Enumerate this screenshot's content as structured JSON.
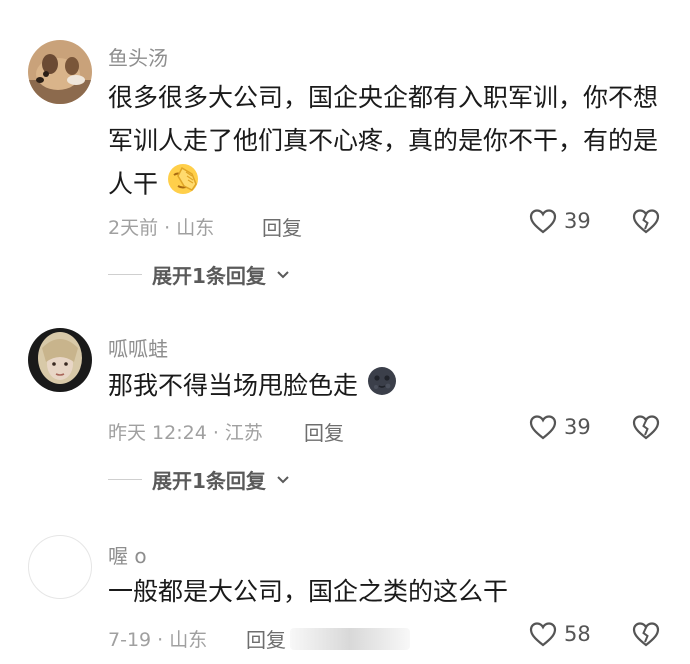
{
  "comments": [
    {
      "username": "鱼头汤",
      "text_before_emoji": "很多很多大公司，国企央企都有入职军训，你不想军训人走了他们真不心疼，真的是你不干，有的是人干",
      "emoji": "face-palm-emoji",
      "meta": "2天前 · 山东",
      "reply": "回复",
      "likes": "39",
      "expand": "展开1条回复"
    },
    {
      "username": "呱呱蛙",
      "text_before_emoji": "那我不得当场甩脸色走",
      "emoji": "new-moon-face-emoji",
      "meta": "昨天 12:24 · 江苏",
      "reply": "回复",
      "likes": "39",
      "expand": "展开1条回复"
    },
    {
      "username": "喔 o",
      "text_before_emoji": "一般都是大公司，国企之类的这么干",
      "meta": "7-19 · 山东",
      "reply": "回复",
      "likes": "58"
    }
  ],
  "icons": {
    "like": "heart-outline-icon",
    "dislike": "broken-heart-icon",
    "expand": "chevron-down-icon"
  }
}
